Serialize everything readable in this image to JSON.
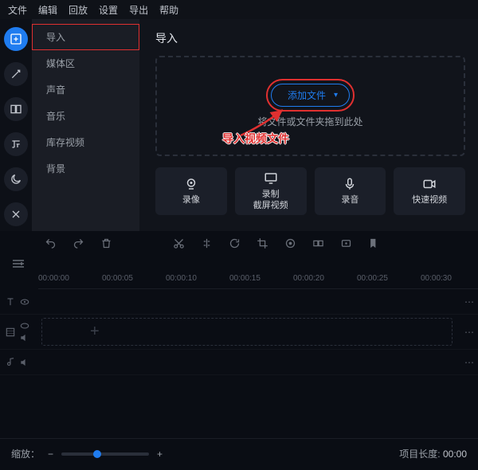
{
  "menubar": {
    "file": "文件",
    "edit": "编辑",
    "playback": "回放",
    "settings": "设置",
    "export": "导出",
    "help": "帮助"
  },
  "sidemenu": {
    "import": "导入",
    "media": "媒体区",
    "sound": "声音",
    "music": "音乐",
    "stock": "库存视频",
    "background": "背景"
  },
  "panel": {
    "title": "导入",
    "addFile": "添加文件",
    "dropHint": "将文件或文件夹拖到此处",
    "annotation": "导入视频文件"
  },
  "capture": {
    "record": "录像",
    "screenRecord": "录制\n截屏视频",
    "audio": "录音",
    "fast": "快速视频"
  },
  "ruler": [
    "00:00:00",
    "00:00:05",
    "00:00:10",
    "00:00:15",
    "00:00:20",
    "00:00:25",
    "00:00:30"
  ],
  "bottom": {
    "zoomLabel": "缩放：",
    "projLenLabel": "项目长度:",
    "projLen": "00:00"
  }
}
